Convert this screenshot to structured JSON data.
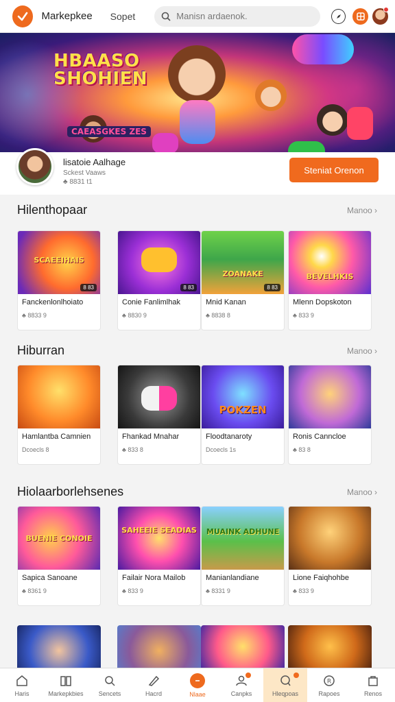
{
  "header": {
    "brand": "Markepkee",
    "nav_link": "Sopet",
    "search_placeholder": "Manisn ardaenok.",
    "icons": [
      "logo-check-icon",
      "compass-icon",
      "grid-icon",
      "avatar"
    ]
  },
  "hero": {
    "title": "HBAASO SHOHIEN",
    "subtitle": "CAEASGKES ZES"
  },
  "profile": {
    "name": "lisatoie Aalhage",
    "meta1": "Sckest Vaaws",
    "meta2": "♣ 8831 t1",
    "cta": "Steniat Orenon"
  },
  "sections": [
    {
      "title": "Hilenthopaar",
      "more": "Manoo ›",
      "cards": [
        {
          "name": "Fanckenlonlhoiato",
          "meta": "♣ 8833 9",
          "badge": "8 83",
          "thumb_text": "SCAEEIHAIS"
        },
        {
          "name": "Conie Fanlimlhak",
          "meta": "♣ 8830 9",
          "badge": "8 83",
          "thumb_text": ""
        },
        {
          "name": "Mnid Kanan",
          "meta": "♣ 8838 8",
          "badge": "8 83",
          "thumb_text": "ZOANAKE"
        },
        {
          "name": "Mlenn Dopskoton",
          "meta": "♣ 833 9",
          "badge": "",
          "thumb_text": "BEVELHKIS"
        }
      ]
    },
    {
      "title": "Hiburran",
      "more": "Manoo ›",
      "cards": [
        {
          "name": "Hamlantba Camnien",
          "meta": "Dcoecls 8",
          "badge": "",
          "thumb_text": ""
        },
        {
          "name": "Fhankad Mnahar",
          "meta": "♣ 833 8",
          "badge": "",
          "thumb_text": ""
        },
        {
          "name": "Floodtanaroty",
          "meta": "Dcoecls 1s",
          "badge": "",
          "thumb_text": "POKZEN"
        },
        {
          "name": "Ronis Canncloe",
          "meta": "♣ 83 8",
          "badge": "",
          "thumb_text": ""
        }
      ]
    },
    {
      "title": "Hiolaarborlehsenes",
      "more": "Manoo ›",
      "cards": [
        {
          "name": "Sapica Sanoane",
          "meta": "♣ 8361 9",
          "badge": "",
          "thumb_text": "BUENIE CONOIE"
        },
        {
          "name": "Failair Nora Mailob",
          "meta": "♣ 833 9",
          "badge": "",
          "thumb_text": "SAHEEIE SEADIAS"
        },
        {
          "name": "Manianlandiane",
          "meta": "♣ 8331 9",
          "badge": "",
          "thumb_text": "MUAINK ADHUNE"
        },
        {
          "name": "Lione Faiqhohbe",
          "meta": "♣ 833 9",
          "badge": "",
          "thumb_text": ""
        }
      ]
    }
  ],
  "bottom_nav": [
    {
      "label": "Haris",
      "icon": "home-icon"
    },
    {
      "label": "Markepkbies",
      "icon": "book-icon"
    },
    {
      "label": "Sencets",
      "icon": "search-icon"
    },
    {
      "label": "Hacrd",
      "icon": "tag-icon"
    },
    {
      "label": "Nlaae",
      "icon": "center-orange-icon"
    },
    {
      "label": "Canpks",
      "icon": "person-icon"
    },
    {
      "label": "Hleqpoas",
      "icon": "chat-icon"
    },
    {
      "label": "Rapoes",
      "icon": "circle-r-icon"
    },
    {
      "label": "Renos",
      "icon": "bag-icon"
    }
  ],
  "colors": {
    "accent": "#ee6a1e",
    "nav_highlight": "#fde7c6",
    "background": "#f3f3f3"
  }
}
